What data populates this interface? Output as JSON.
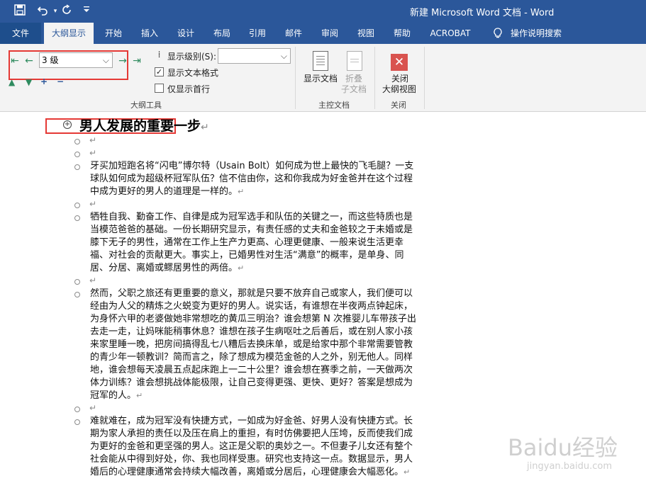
{
  "window": {
    "title": "新建 Microsoft Word 文档  -  Word"
  },
  "quick_access": {
    "save_icon": "save-icon",
    "undo_icon": "undo-icon",
    "redo_icon": "redo-icon",
    "customize_icon": "customize-icon"
  },
  "tabs": [
    {
      "label": "文件"
    },
    {
      "label": "大纲显示"
    },
    {
      "label": "开始"
    },
    {
      "label": "插入"
    },
    {
      "label": "设计"
    },
    {
      "label": "布局"
    },
    {
      "label": "引用"
    },
    {
      "label": "邮件"
    },
    {
      "label": "审阅"
    },
    {
      "label": "视图"
    },
    {
      "label": "帮助"
    },
    {
      "label": "ACROBAT"
    },
    {
      "label": "操作说明搜索"
    }
  ],
  "outline_tools": {
    "level_value": "3 级",
    "show_level_label": "显示级别(S):",
    "show_level_value": "",
    "show_text_format_label": "显示文本格式",
    "show_text_format_checked": true,
    "show_first_line_label": "仅显示首行",
    "show_first_line_checked": false,
    "group_label": "大纲工具"
  },
  "master_doc": {
    "show_document_label": "显示文档",
    "collapse_subdoc_label_1": "折叠",
    "collapse_subdoc_label_2": "子文档",
    "group_label": "主控文档"
  },
  "close_group": {
    "close_label_1": "关闭",
    "close_label_2": "大纲视图",
    "group_label": "关闭"
  },
  "document": {
    "heading": "男人发展的重要一步",
    "para_mark": "↵",
    "paragraphs": [
      "牙买加短跑名将“闪电”博尔特（Usain Bolt）如何成为世上最快的飞毛腿？一支球队如何成为超级杯冠军队伍？信不信由你，这和你我成为好金爸并在这个过程中成为更好的男人的道理是一样的。",
      "牺牲自我、勤奋工作、自律是成为冠军选手和队伍的关键之一，而这些特质也是当模范爸爸的基础。一份长期研究显示，有责任感的丈夫和金爸较之于未婚或是膝下无子的男性，通常在工作上生产力更高、心理更健康、一般来说生活更幸福、对社会的贡献更大。事实上，已婚男性对生活“满意”的概率，是单身、同居、分居、离婚或鳏居男性的两倍。",
      "然而，父职之旅还有更重要的意义，那就是只要不放弃自己或家人，我们便可以经由为人父的精炼之火蜕变为更好的男人。说实话，有谁想在半夜两点钟起床，为身怀六甲的老婆做她非常想吃的黄瓜三明治？谁会想第 N 次推婴儿车带孩子出去走一走，让妈咪能稍事休息？谁想在孩子生病呕吐之后善后，或在别人家小孩来家里睡一晚，把房间搞得乱七八糟后去换床单，或是给家中那个非常需要管教的青少年一顿教训？简而言之，除了想成为模范金爸的人之外，别无他人。同样地，谁会想每天凌晨五点起床跑上一二十公里？谁会想在赛季之前，一天做两次体力训练？谁会想挑战体能极限，让自己变得更强、更快、更好？答案是想成为冠军的人。",
      "难就难在，成为冠军没有快捷方式，一如成为好金爸、好男人没有快捷方式。长期为家人承担的责任以及压在肩上的重担，有时仿佛要把人压垮，反而使我们成为更好的金爸和更坚强的男人。这正是父职的奥妙之一。不但妻子儿女还有整个社会能从中得到好处，你、我也同样受惠。研究也支持这一点。数据显示，男人婚后的心理健康通常会持续大幅改善，离婚或分居后，心理健康会大幅恶化。"
    ]
  },
  "watermark": {
    "brand": "Baidu经验",
    "url": "jingyan.baidu.com"
  }
}
